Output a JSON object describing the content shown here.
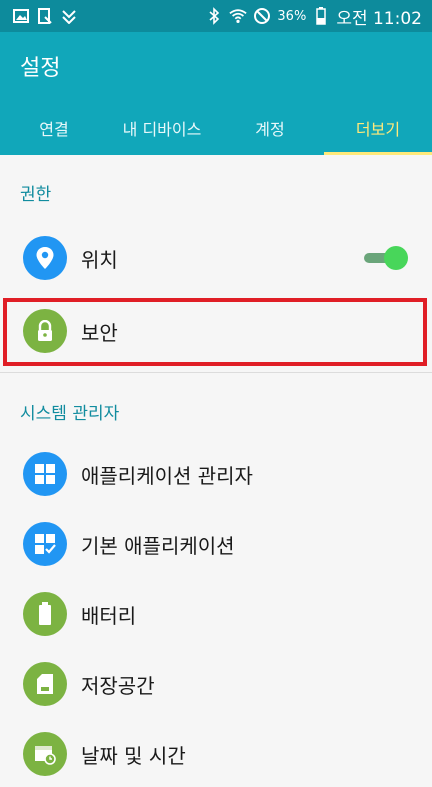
{
  "status": {
    "battery": "36%",
    "time": "오전 11:02"
  },
  "header": {
    "title": "설정"
  },
  "tabs": [
    {
      "label": "연결",
      "active": false
    },
    {
      "label": "내 디바이스",
      "active": false
    },
    {
      "label": "계정",
      "active": false
    },
    {
      "label": "더보기",
      "active": true
    }
  ],
  "sections": [
    {
      "title": "권한",
      "items": [
        {
          "label": "위치",
          "icon": "location-icon",
          "color": "#2196f3",
          "toggle_on": true
        },
        {
          "label": "보안",
          "icon": "lock-icon",
          "color": "#7cb342"
        }
      ]
    },
    {
      "title": "시스템 관리자",
      "items": [
        {
          "label": "애플리케이션 관리자",
          "icon": "apps-grid-icon",
          "color": "#2196f3"
        },
        {
          "label": "기본 애플리케이션",
          "icon": "default-apps-icon",
          "color": "#2196f3"
        },
        {
          "label": "배터리",
          "icon": "battery-icon",
          "color": "#7cb342"
        },
        {
          "label": "저장공간",
          "icon": "sd-card-icon",
          "color": "#7cb342"
        },
        {
          "label": "날짜 및 시간",
          "icon": "calendar-clock-icon",
          "color": "#7cb342"
        }
      ]
    }
  ],
  "colors": {
    "statusbar": "#0d8b9c",
    "appbar": "#11a7ba",
    "active_tab": "#ffe97a",
    "section_header": "#118c9f",
    "highlight": "#e01e26"
  }
}
